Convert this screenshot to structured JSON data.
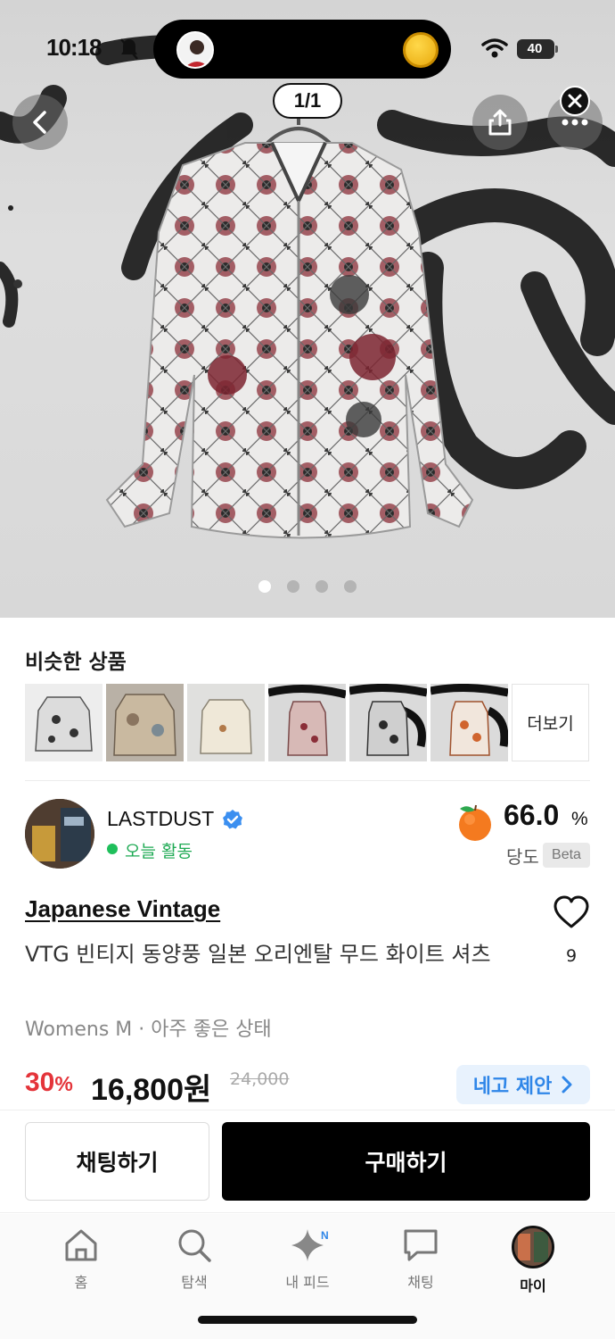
{
  "status_bar": {
    "time": "10:18",
    "battery": "40"
  },
  "viewer": {
    "counter": "1/1",
    "dots_total": 4,
    "dots_active": 1
  },
  "similar": {
    "title": "비슷한 상품",
    "more_label": "더보기",
    "thumb_count": 6
  },
  "seller": {
    "name": "LASTDUST",
    "activity": "오늘 활동",
    "sweetness_value": "66.0",
    "sweetness_unit": "%",
    "sweetness_label": "당도",
    "beta_label": "Beta"
  },
  "product": {
    "brand": "Japanese Vintage",
    "title": "VTG 빈티지 동양풍 일본 오리엔탈 무드 화이트 셔츠",
    "condition": "Womens M · 아주 좋은 상태",
    "likes": "9",
    "discount": "30",
    "discount_unit": "%",
    "price": "16,800원",
    "original_price": "24,000",
    "offer_label": "네고 제안"
  },
  "actions": {
    "chat_label": "채팅하기",
    "buy_label": "구매하기"
  },
  "tabbar": {
    "items": [
      {
        "label": "홈"
      },
      {
        "label": "탐색"
      },
      {
        "label": "내 피드",
        "badge": "N"
      },
      {
        "label": "채팅"
      },
      {
        "label": "마이"
      }
    ]
  },
  "colors": {
    "accent_blue": "#2f86e8",
    "discount_red": "#e4343a",
    "active_green": "#1faa54",
    "buy_button": "#000000"
  }
}
